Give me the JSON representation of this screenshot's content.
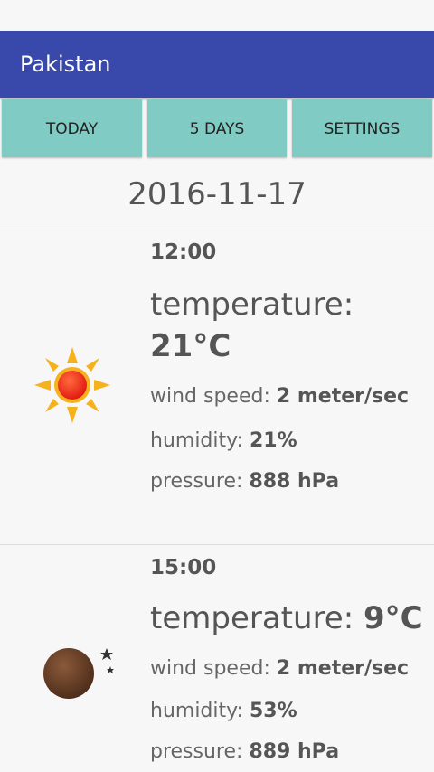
{
  "appbar": {
    "title": "Pakistan",
    "color": "#3949ab"
  },
  "tabs": [
    {
      "label": "TODAY"
    },
    {
      "label": "5 DAYS"
    },
    {
      "label": "SETTINGS"
    }
  ],
  "tab_color": "#80cbc4",
  "date": "2016-11-17",
  "forecasts": [
    {
      "time": "12:00",
      "temp_label": "temperature:",
      "temp_value": "21°C",
      "wind_label": "wind speed:",
      "wind_value": "2 meter/sec",
      "humidity_label": "humidity:",
      "humidity_value": "21%",
      "pressure_label": "pressure:",
      "pressure_value": "888 hPa",
      "icon": "sun-icon"
    },
    {
      "time": "15:00",
      "temp_label": "temperature:",
      "temp_value": "9°C",
      "wind_label": "wind speed:",
      "wind_value": "2 meter/sec",
      "humidity_label": "humidity:",
      "humidity_value": "53%",
      "pressure_label": "pressure:",
      "pressure_value": "889 hPa",
      "icon": "night-moon-icon"
    }
  ]
}
